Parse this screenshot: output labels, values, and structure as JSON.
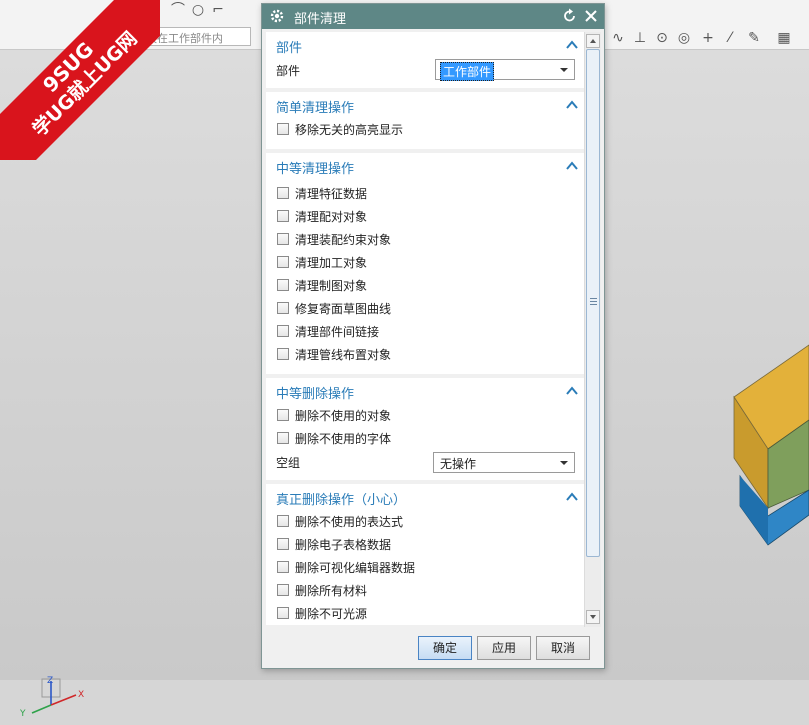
{
  "toolbar": {
    "selection_filter": "仅在工作部件内"
  },
  "watermark": {
    "line1": "9SUG",
    "line2": "学UG就上UG网"
  },
  "dialog": {
    "title": "部件清理",
    "sections": {
      "part": {
        "header": "部件",
        "field_label": "部件",
        "selected_value": "工作部件"
      },
      "simple": {
        "header": "简单清理操作",
        "items": [
          "移除无关的高亮显示"
        ]
      },
      "medium_clean": {
        "header": "中等清理操作",
        "items": [
          "清理特征数据",
          "清理配对对象",
          "清理装配约束对象",
          "清理加工对象",
          "清理制图对象",
          "修复寄面草图曲线",
          "清理部件间链接",
          "清理管线布置对象"
        ]
      },
      "medium_delete": {
        "header": "中等删除操作",
        "items": [
          "删除不使用的对象",
          "删除不使用的字体"
        ],
        "group_label": "空组",
        "group_value": "无操作"
      },
      "real_delete": {
        "header": "真正删除操作（小心）",
        "items": [
          "删除不使用的表达式",
          "删除电子表格数据",
          "删除可视化编辑器数据",
          "删除所有材料",
          "删除不可光源"
        ]
      }
    },
    "buttons": {
      "ok": "确定",
      "apply": "应用",
      "cancel": "取消"
    }
  },
  "colors": {
    "titlebar": "#5e8786",
    "section_header": "#2a7cb8",
    "selection": "#3399ff"
  }
}
